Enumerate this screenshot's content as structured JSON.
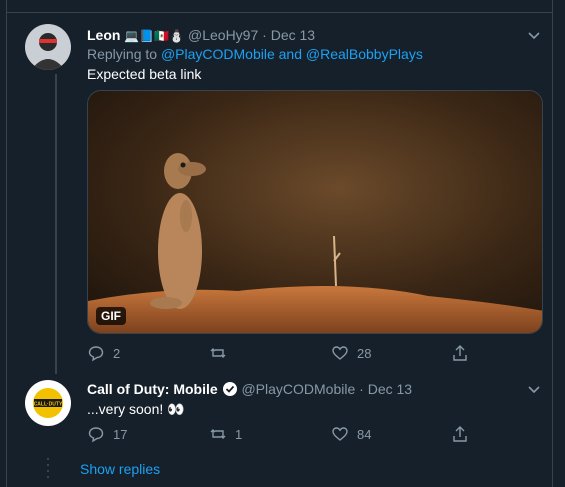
{
  "tweets": [
    {
      "display_name": "Leon",
      "name_emojis": "💻📘🇲🇽⛄",
      "handle": "@LeoHy97",
      "separator": "·",
      "date": "Dec 13",
      "replying_prefix": "Replying to",
      "replying_to_1": "@PlayCODMobile",
      "replying_and": "and",
      "replying_to_2": "@RealBobbyPlays",
      "text": "Expected beta link",
      "media_badge": "GIF",
      "reply_count": "2",
      "retweet_count": "",
      "like_count": "28"
    },
    {
      "display_name": "Call of Duty: Mobile",
      "handle": "@PlayCODMobile",
      "separator": "·",
      "date": "Dec 13",
      "text": "...very soon! 👀",
      "reply_count": "17",
      "retweet_count": "1",
      "like_count": "84"
    }
  ],
  "show_replies": "Show replies",
  "colors": {
    "background": "#15202b",
    "muted": "#8899a6",
    "accent": "#1da1f2",
    "border": "#38444d"
  }
}
